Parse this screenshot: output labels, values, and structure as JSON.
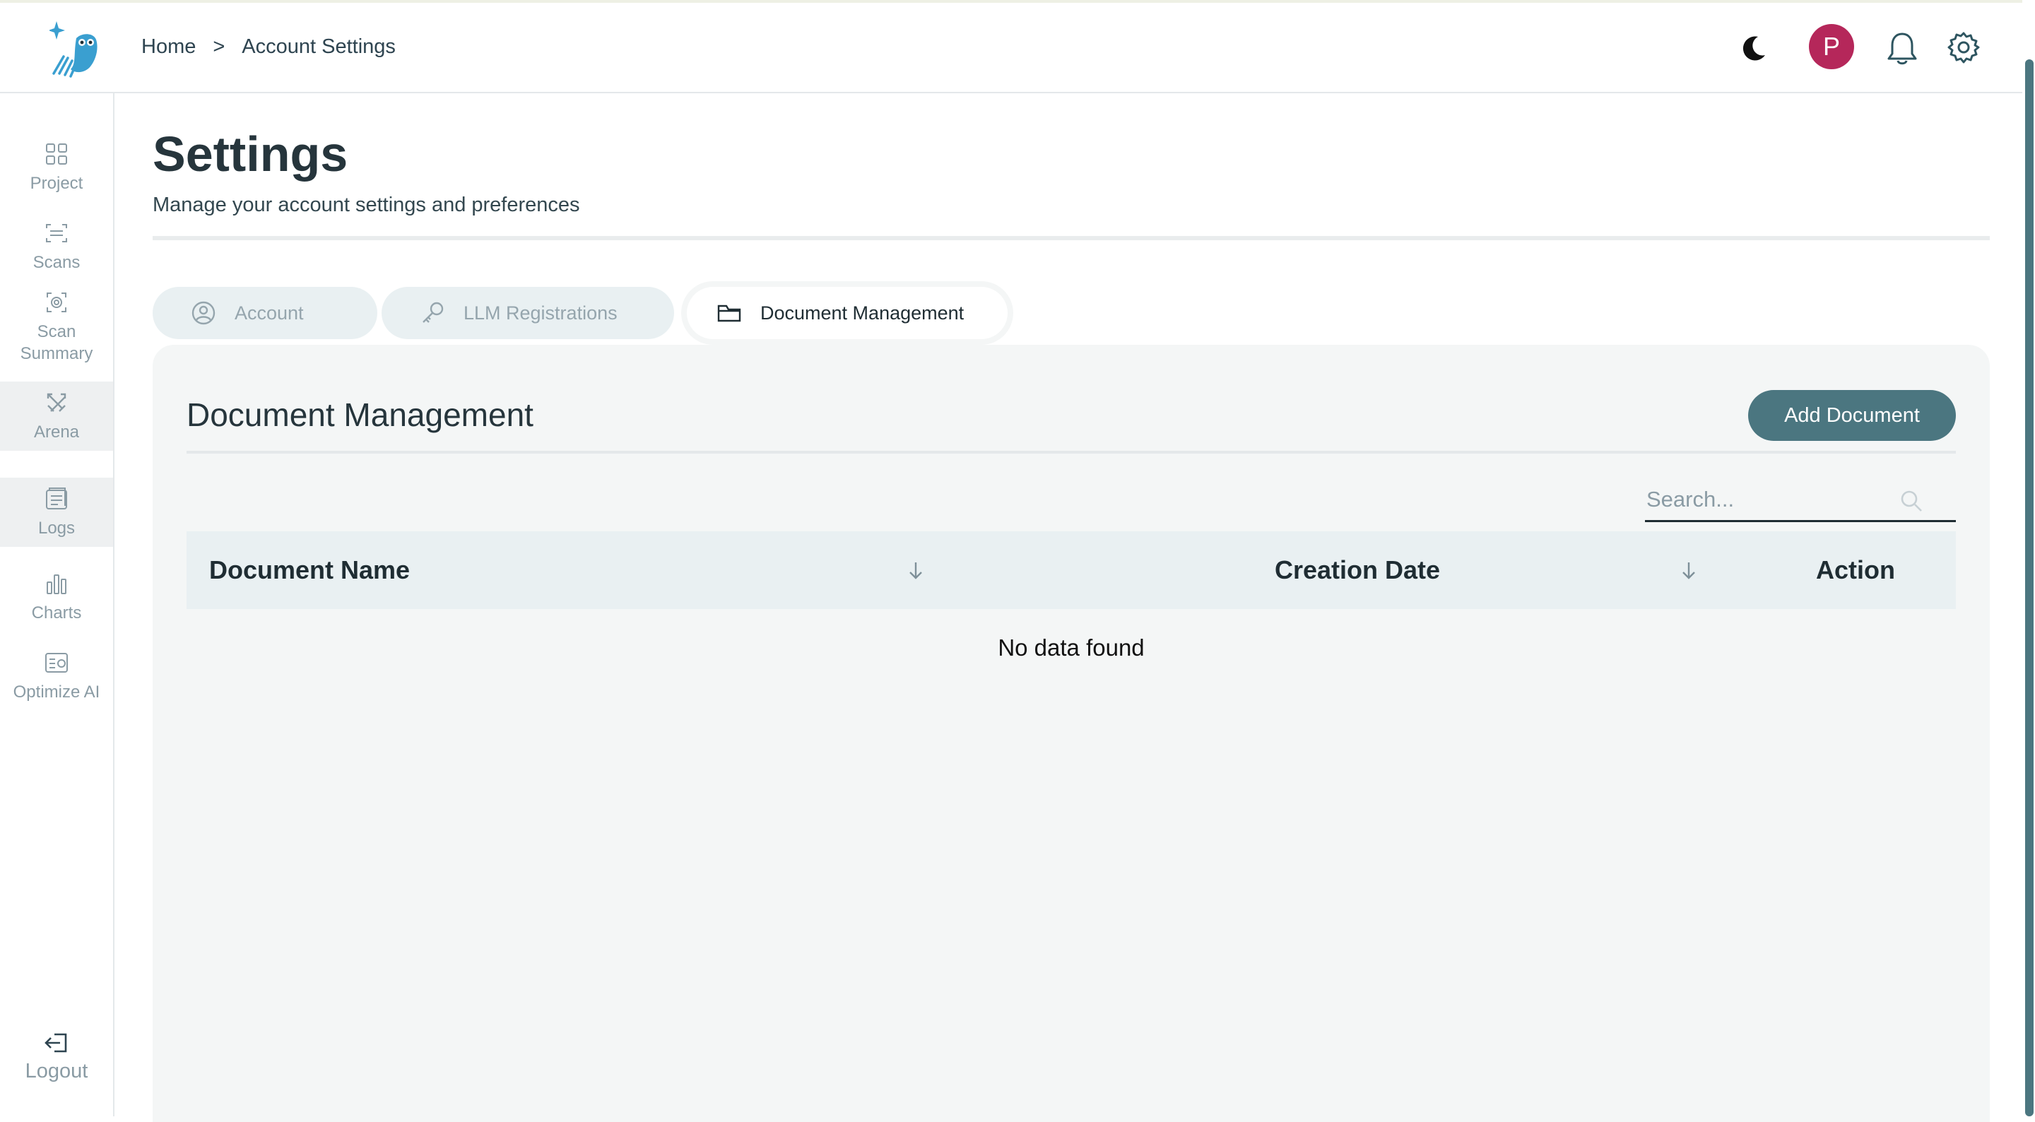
{
  "header": {
    "breadcrumb": {
      "home": "Home",
      "separator": ">",
      "current": "Account Settings"
    },
    "avatar_initial": "P",
    "icons": [
      "logo-owl-icon",
      "moon-icon",
      "bell-icon",
      "gear-icon"
    ]
  },
  "sidebar": {
    "items": [
      {
        "label": "Project",
        "icon": "grid-icon"
      },
      {
        "label": "Scans",
        "icon": "scan-icon"
      },
      {
        "label": "Scan Summary",
        "icon": "scan-summary-icon"
      },
      {
        "label": "Arena",
        "icon": "swords-icon"
      },
      {
        "label": "Logs",
        "icon": "logs-icon"
      },
      {
        "label": "Charts",
        "icon": "bar-chart-icon"
      },
      {
        "label": "Optimize AI",
        "icon": "optimize-icon"
      }
    ],
    "logout": "Logout"
  },
  "page": {
    "title": "Settings",
    "subtitle": "Manage your account settings and preferences"
  },
  "tabs": [
    {
      "label": "Account",
      "icon": "user-circle-icon"
    },
    {
      "label": "LLM Registrations",
      "icon": "key-icon"
    },
    {
      "label": "Document Management",
      "icon": "folder-icon",
      "active": true
    }
  ],
  "panel": {
    "title": "Document Management",
    "add_button": "Add Document",
    "search_placeholder": "Search...",
    "columns": [
      "Document Name",
      "Creation Date",
      "Action"
    ],
    "empty_text": "No data found"
  },
  "colors": {
    "accent": "#4b7680",
    "avatar": "#b5275a",
    "logo": "#3a9fd0"
  }
}
